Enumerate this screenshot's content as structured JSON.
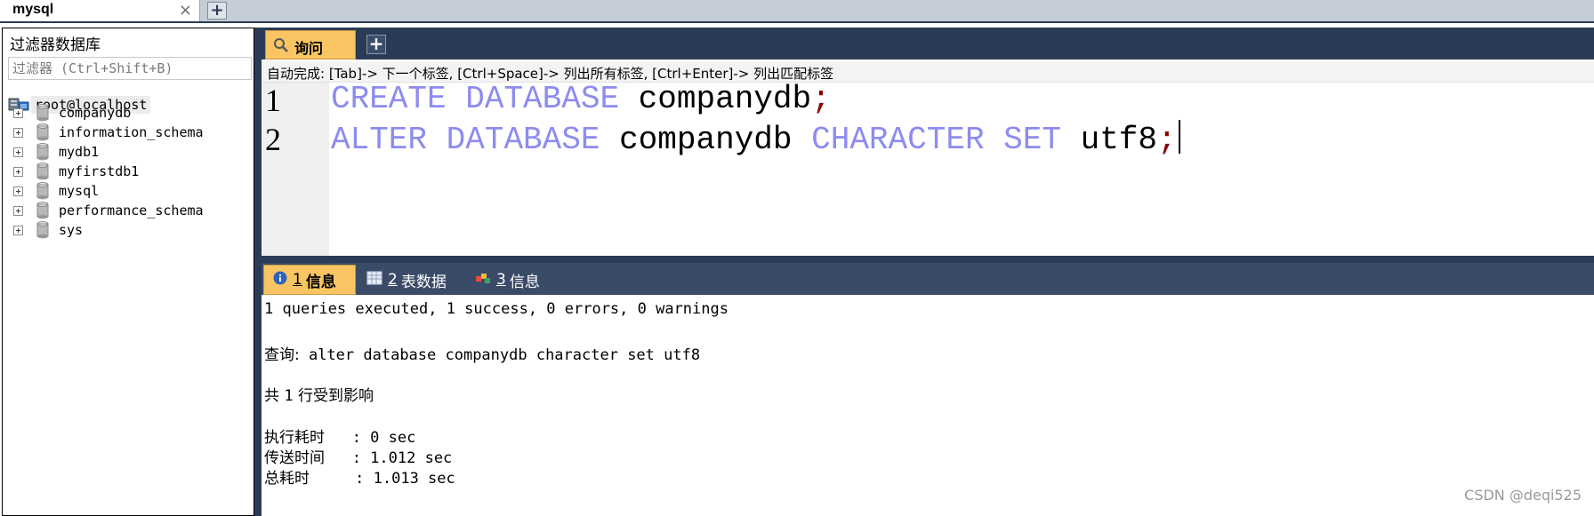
{
  "connection_tabs": [
    {
      "title": "mysql",
      "close": "×"
    }
  ],
  "connection_add": "+",
  "left_panel": {
    "filter_title": "过滤器数据库",
    "filter_placeholder": "过滤器 (Ctrl+Shift+B)",
    "root": "root@localhost",
    "databases": [
      "companydb",
      "information_schema",
      "mydb1",
      "myfirstdb1",
      "mysql",
      "performance_schema",
      "sys"
    ]
  },
  "query_tab": {
    "label": "询问",
    "add": "+"
  },
  "hint": "自动完成: [Tab]-> 下一个标签, [Ctrl+Space]-> 列出所有标签, [Ctrl+Enter]-> 列出匹配标签",
  "editor": {
    "lines": [
      {
        "number": "1",
        "kw1": "CREATE",
        "kw2": "DATABASE",
        "ident": "companydb",
        "rest": "",
        "semi": ";"
      },
      {
        "number": "2",
        "kw1": "ALTER",
        "kw2": "DATABASE",
        "ident": "companydb",
        "kw3": "CHARACTER",
        "kw4": "SET",
        "ident2": "utf8",
        "semi": ";"
      }
    ]
  },
  "result_tabs": [
    {
      "num": "1",
      "label": "信息",
      "active": true
    },
    {
      "num": "2",
      "label": "表数据",
      "active": false
    },
    {
      "num": "3",
      "label": "信息",
      "active": false
    }
  ],
  "output": {
    "summary": "1 queries executed, 1 success, 0 errors, 0 warnings",
    "query_label": "查询:",
    "query_text": " alter database companydb character set utf8",
    "affected_prefix": "共 ",
    "affected_num": "1",
    "affected_suffix": " 行受到影响",
    "exec_label": "执行耗时",
    "exec_value": "   : 0 sec",
    "transfer_label": "传送时间",
    "transfer_value": "   : 1.012 sec",
    "total_label": "总耗时",
    "total_value": "     : 1.013 sec"
  },
  "watermark": "CSDN @deqi525",
  "colors": {
    "accent_dark": "#2b3b55",
    "active_tab": "#f8c562",
    "keyword": "#8c8cf0",
    "semicolon": "#8b0000"
  }
}
